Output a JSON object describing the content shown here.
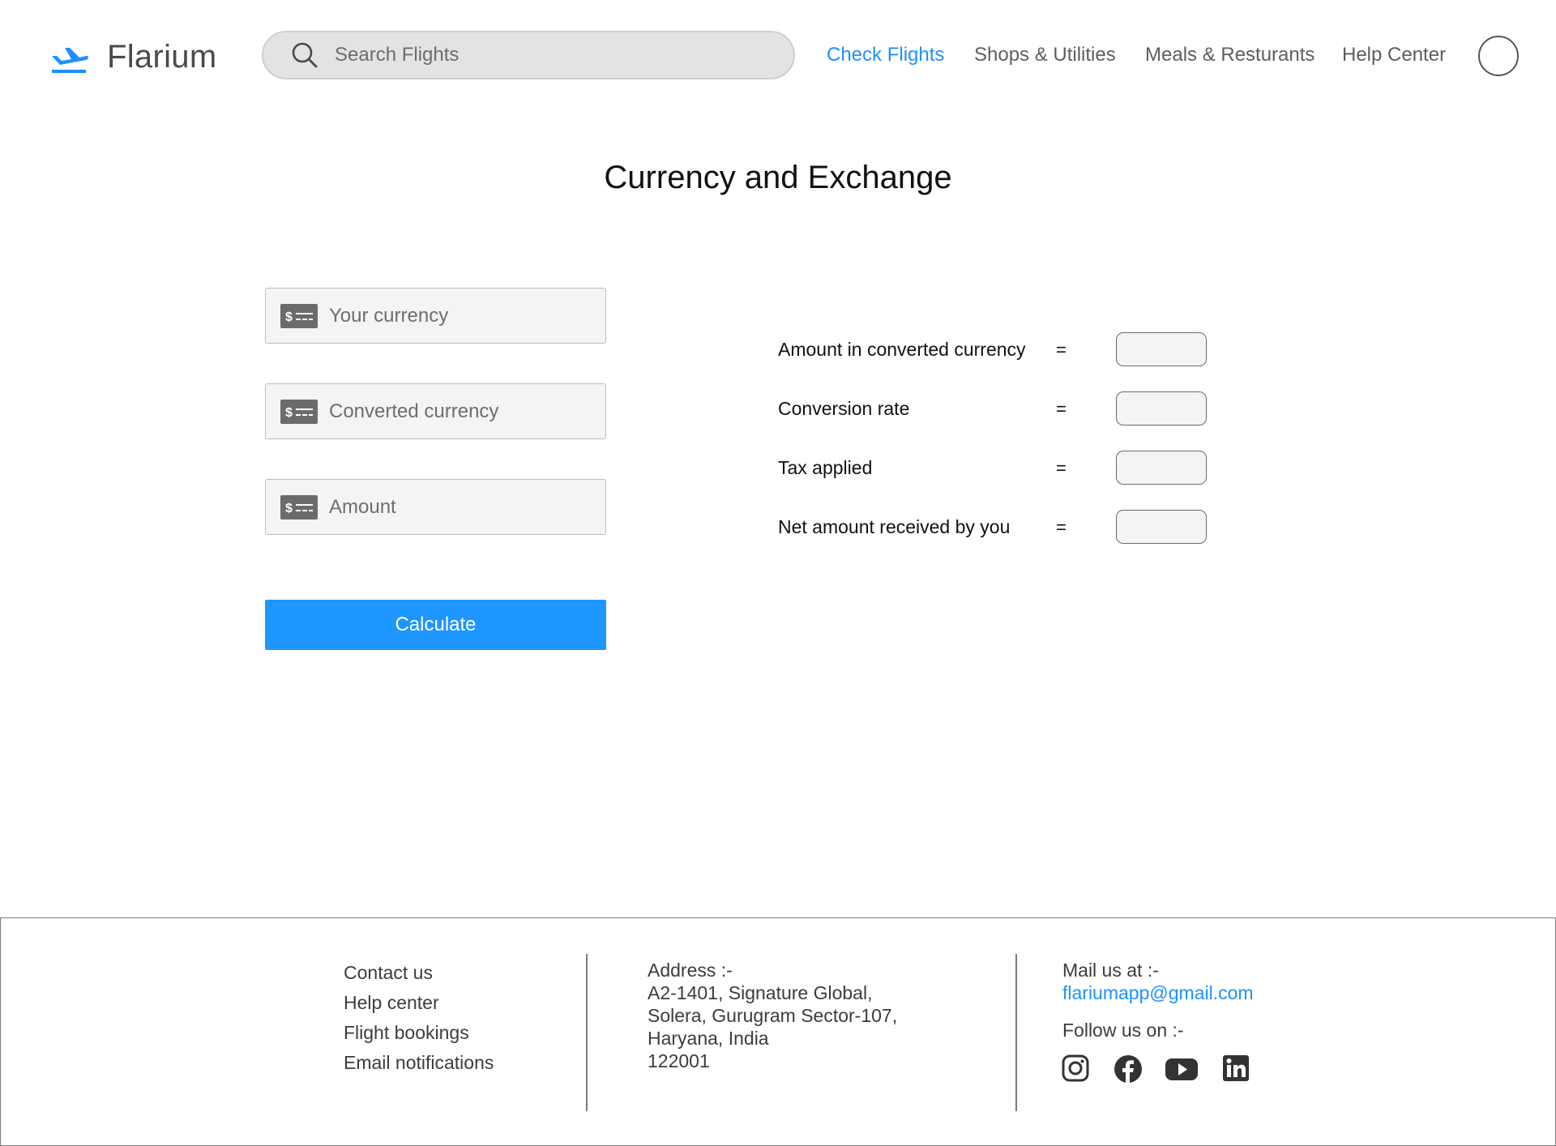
{
  "header": {
    "brand": "Flarium",
    "search_placeholder": "Search Flights",
    "nav": [
      {
        "label": "Check Flights",
        "active": true
      },
      {
        "label": "Shops & Utilities",
        "active": false
      },
      {
        "label": "Meals & Resturants",
        "active": false
      },
      {
        "label": "Help Center",
        "active": false
      }
    ]
  },
  "main": {
    "title": "Currency and Exchange",
    "fields": [
      {
        "placeholder": "Your currency",
        "icon": "cash-icon"
      },
      {
        "placeholder": "Converted currency",
        "icon": "cash-icon"
      },
      {
        "placeholder": "Amount",
        "icon": "cash-icon"
      }
    ],
    "calculate_label": "Calculate",
    "results": [
      {
        "label": "Amount in converted currency",
        "eq": "="
      },
      {
        "label": "Conversion rate",
        "eq": "="
      },
      {
        "label": "Tax applied",
        "eq": "="
      },
      {
        "label": "Net amount received by you",
        "eq": "="
      }
    ]
  },
  "footer": {
    "links": [
      "Contact us",
      "Help center",
      "Flight bookings",
      "Email notifications"
    ],
    "address_lines": [
      "Address :-",
      "A2-1401, Signature Global,",
      "Solera, Gurugram Sector-107,",
      "Haryana, India",
      "122001"
    ],
    "mail_label": "Mail us at :-",
    "mail_address": "flariumapp@gmail.com",
    "follow_label": "Follow us on :-",
    "socials": [
      "instagram-icon",
      "facebook-icon",
      "youtube-icon",
      "linkedin-icon"
    ]
  },
  "colors": {
    "accent": "#1e90ff",
    "button": "#1e96ff",
    "nav_text": "#5e5e5e",
    "field_bg": "#f4f4f4"
  }
}
